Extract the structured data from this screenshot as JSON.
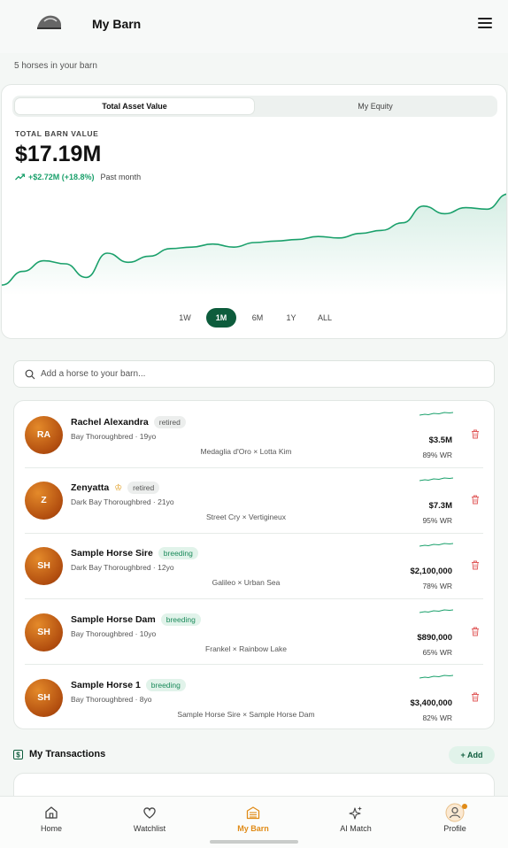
{
  "header": {
    "title": "My Barn"
  },
  "summary": {
    "count_text": "5 horses in your barn"
  },
  "value_card": {
    "tabs": [
      "Total Asset Value",
      "My Equity"
    ],
    "label": "TOTAL BARN VALUE",
    "value": "$17.19M",
    "change": "+$2.72M (+18.8%)",
    "period": "Past month",
    "ranges": [
      "1W",
      "1M",
      "6M",
      "1Y",
      "ALL"
    ],
    "active_range": "1M"
  },
  "chart_data": {
    "type": "area",
    "series": [
      {
        "values": [
          12.7,
          13.6,
          14.3,
          14.1,
          13.2,
          14.8,
          14.2,
          14.6,
          15.1,
          15.2,
          15.4,
          15.2,
          15.5,
          15.6,
          15.7,
          15.9,
          15.8,
          16.1,
          16.3,
          16.8,
          17.9,
          17.4,
          17.8,
          17.7,
          18.7
        ]
      }
    ],
    "color": "#1aa06b"
  },
  "search": {
    "placeholder": "Add a horse to your barn..."
  },
  "horses": [
    {
      "initials": "RA",
      "name": "Rachel Alexandra",
      "badge": "retired",
      "crown": false,
      "breed": "Bay Thoroughbred · 19yo",
      "pedigree": "Medaglia d'Oro × Lotta Kim",
      "price": "$3.5M",
      "wr": "89% WR"
    },
    {
      "initials": "Z",
      "name": "Zenyatta",
      "badge": "retired",
      "crown": true,
      "breed": "Dark Bay Thoroughbred · 21yo",
      "pedigree": "Street Cry × Vertigineux",
      "price": "$7.3M",
      "wr": "95% WR"
    },
    {
      "initials": "SH",
      "name": "Sample Horse Sire",
      "badge": "breeding",
      "crown": false,
      "breed": "Dark Bay Thoroughbred · 12yo",
      "pedigree": "Galileo × Urban Sea",
      "price": "$2,100,000",
      "wr": "78% WR"
    },
    {
      "initials": "SH",
      "name": "Sample Horse Dam",
      "badge": "breeding",
      "crown": false,
      "breed": "Bay Thoroughbred · 10yo",
      "pedigree": "Frankel × Rainbow Lake",
      "price": "$890,000",
      "wr": "65% WR"
    },
    {
      "initials": "SH",
      "name": "Sample Horse 1",
      "badge": "breeding",
      "crown": false,
      "breed": "Bay Thoroughbred · 8yo",
      "pedigree": "Sample Horse Sire × Sample Horse Dam",
      "price": "$3,400,000",
      "wr": "82% WR"
    }
  ],
  "transactions": {
    "title": "My Transactions",
    "add_label": "+ Add"
  },
  "tabbar": {
    "items": [
      {
        "label": "Home",
        "icon": "home-icon"
      },
      {
        "label": "Watchlist",
        "icon": "heart-icon"
      },
      {
        "label": "My Barn",
        "icon": "barn-icon"
      },
      {
        "label": "AI Match",
        "icon": "sparkle-icon"
      },
      {
        "label": "Profile",
        "icon": "profile-icon"
      }
    ],
    "active": "My Barn"
  },
  "colors": {
    "accent": "#0d5c3c",
    "positive": "#1aa06b",
    "active_tab": "#e08b17",
    "trash": "#e05a5a"
  }
}
